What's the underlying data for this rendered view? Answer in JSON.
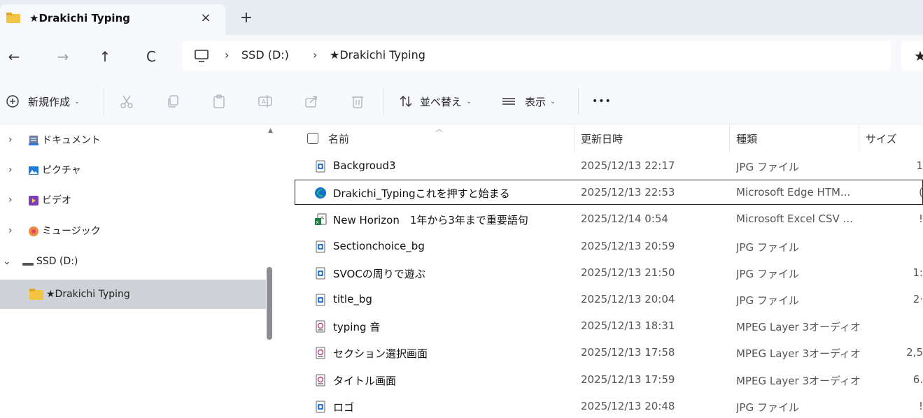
{
  "tab": {
    "title": "★Drakichi Typing",
    "close_glyph": "×",
    "new_tab_glyph": "+"
  },
  "nav": {
    "back": "←",
    "forward": "→",
    "up": "↑",
    "refresh": "C"
  },
  "address": {
    "sep": "›",
    "crumbs": [
      "SSD (D:)",
      "★Drakichi Typing"
    ],
    "right_glyph": "★"
  },
  "toolbar": {
    "new_label": "新規作成",
    "sort_label": "並べ替え",
    "view_label": "表示",
    "more_label": "•••",
    "chevron": "⌄"
  },
  "tree": {
    "items": [
      {
        "label": "ドキュメント",
        "expander": "›"
      },
      {
        "label": "ピクチャ",
        "expander": "›"
      },
      {
        "label": "ビデオ",
        "expander": "›"
      },
      {
        "label": "ミュージック",
        "expander": "›"
      },
      {
        "label": "SSD (D:)",
        "expander": "⌄"
      },
      {
        "label": "★Drakichi Typing",
        "expander": ""
      }
    ]
  },
  "columns": {
    "name": "名前",
    "date": "更新日時",
    "type": "種類",
    "size": "サイズ"
  },
  "files": [
    {
      "name": "Backgroud3",
      "date": "2025/12/13 22:17",
      "type": "JPG ファイル",
      "size": "1",
      "icon": "jpg-icon"
    },
    {
      "name": "Drakichi_Typingこれを押すと始まる",
      "date": "2025/12/13 22:53",
      "type": "Microsoft Edge HTM...",
      "size": "(",
      "icon": "edge-icon"
    },
    {
      "name": "New Horizon　1年から3年まで重要語句",
      "date": "2025/12/14 0:54",
      "type": "Microsoft Excel CSV ...",
      "size": "!",
      "icon": "excel-csv-icon"
    },
    {
      "name": "Sectionchoice_bg",
      "date": "2025/12/13 20:59",
      "type": "JPG ファイル",
      "size": "",
      "icon": "jpg-icon"
    },
    {
      "name": "SVOCの周りで遊ぶ",
      "date": "2025/12/13 21:50",
      "type": "JPG ファイル",
      "size": "1:",
      "icon": "jpg-icon"
    },
    {
      "name": "title_bg",
      "date": "2025/12/13 20:04",
      "type": "JPG ファイル",
      "size": "2·",
      "icon": "jpg-icon"
    },
    {
      "name": "typing 音",
      "date": "2025/12/13 18:31",
      "type": "MPEG Layer 3オーディオ",
      "size": "",
      "icon": "mp3-icon"
    },
    {
      "name": "セクション選択画面",
      "date": "2025/12/13 17:58",
      "type": "MPEG Layer 3オーディオ",
      "size": "2,5",
      "icon": "mp3-icon"
    },
    {
      "name": "タイトル画面",
      "date": "2025/12/13 17:59",
      "type": "MPEG Layer 3オーディオ",
      "size": "6.",
      "icon": "mp3-icon"
    },
    {
      "name": "ロゴ",
      "date": "2025/12/13 20:48",
      "type": "JPG ファイル",
      "size": "!",
      "icon": "jpg-icon"
    }
  ],
  "colors": {
    "folder": "#f7c948",
    "accent": "#0067c0",
    "selection": "#cfd3d8"
  }
}
